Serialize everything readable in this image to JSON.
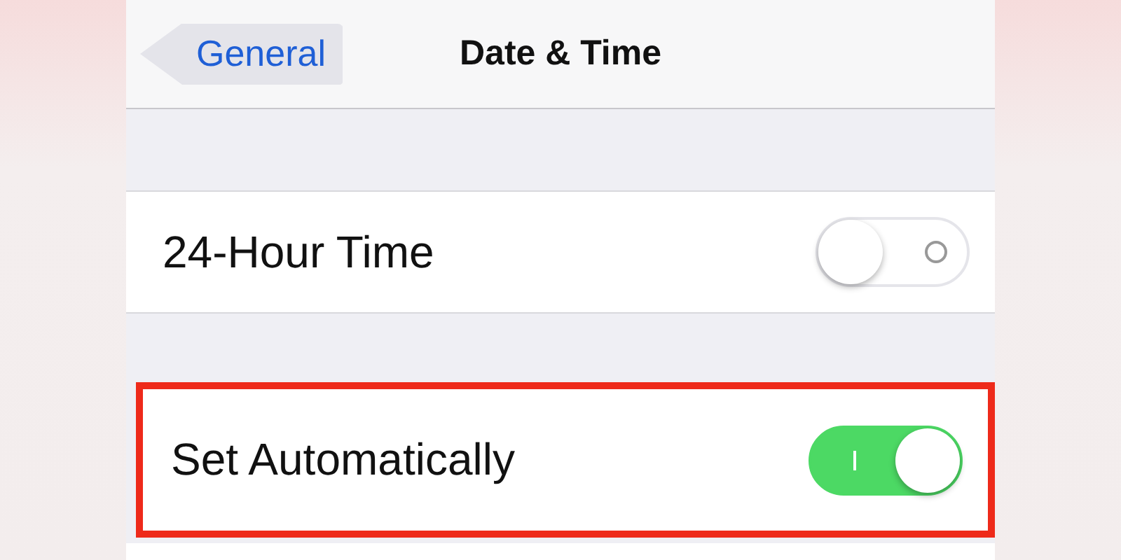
{
  "nav": {
    "back": "General",
    "title": "Date & Time"
  },
  "rows": [
    {
      "label": "24-Hour Time",
      "on": false,
      "highlighted": false
    },
    {
      "label": "Set Automatically",
      "on": true,
      "highlighted": true
    }
  ]
}
